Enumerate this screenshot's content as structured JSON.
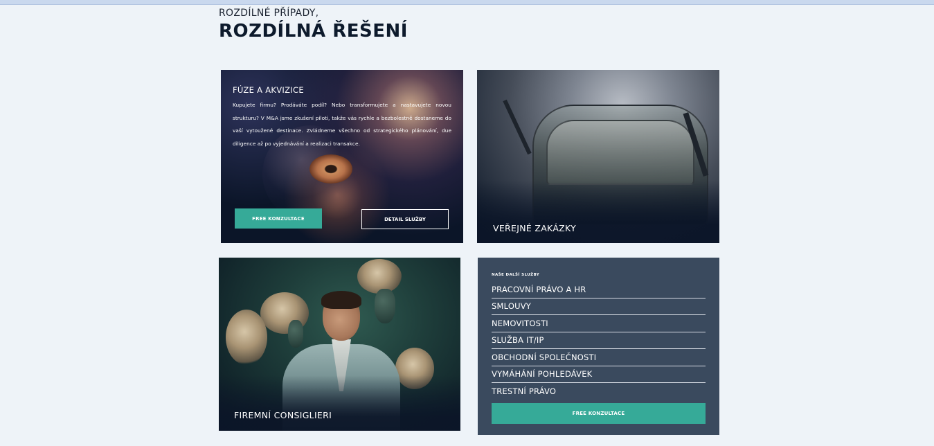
{
  "header": {
    "subtitle": "ROZDÍLNÉ PŘÍPADY,",
    "title": "ROZDÍLNÁ ŘEŠENÍ"
  },
  "cards": {
    "ma": {
      "title": "FÚZE A AKVIZICE",
      "text": "Kupujete firmu? Prodáváte podíl? Nebo transformujete a nastavujete novou strukturu? V M&A jsme zkušení piloti, takže vás rychle a bezbolestně dostaneme do vaší vytoužené destinace. Zvládneme všechno od strategického plánování, due diligence až po vyjednávání a realizaci transakce.",
      "primary_button": "FREE KONZULTACE",
      "secondary_button": "DETAIL SLUŽBY"
    },
    "bus": {
      "title": "VEŘEJNÉ ZAKÁZKY"
    },
    "consiglieri": {
      "title": "FIREMNÍ CONSIGLIERI"
    },
    "services": {
      "heading": "NAŠE DALŠÍ SLUŽBY",
      "items": [
        "PRACOVNÍ PRÁVO A HR",
        "SMLOUVY",
        "NEMOVITOSTI",
        "SLUŽBA IT/IP",
        "OBCHODNÍ SPOLEČNOSTI",
        "VYMÁHÁNÍ POHLEDÁVEK",
        "TRESTNÍ PRÁVO"
      ],
      "button": "FREE KONZULTACE"
    }
  },
  "colors": {
    "accent": "#36aa98",
    "page_bg": "#eef3f8",
    "services_bg": "#3a4a5e",
    "heading": "#0d1a2c"
  }
}
